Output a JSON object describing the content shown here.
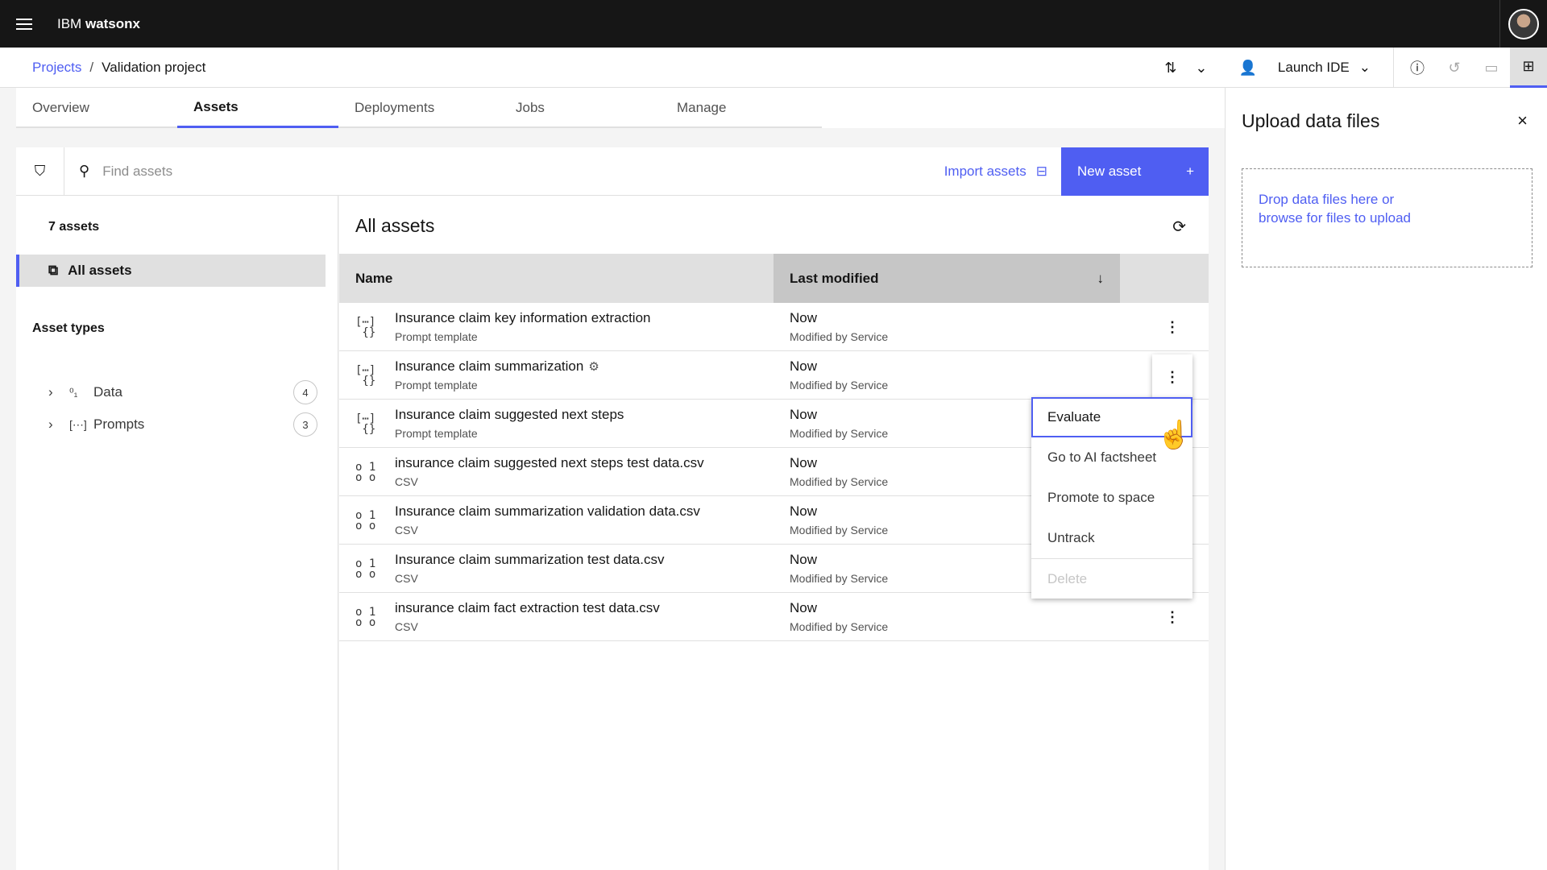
{
  "topbar": {
    "brand_prefix": "IBM",
    "brand_name": "watsonx"
  },
  "breadcrumb": {
    "projects": "Projects",
    "separator": "/",
    "current": "Validation project"
  },
  "header": {
    "launch_ide": "Launch IDE"
  },
  "tabs": [
    {
      "label": "Overview"
    },
    {
      "label": "Assets"
    },
    {
      "label": "Deployments"
    },
    {
      "label": "Jobs"
    },
    {
      "label": "Manage"
    }
  ],
  "toolbar": {
    "search_placeholder": "Find assets",
    "import_label": "Import assets",
    "new_asset_label": "New asset",
    "new_asset_plus": "+"
  },
  "left": {
    "asset_count": "7 assets",
    "all_assets": "All assets",
    "types_title": "Asset types",
    "types": [
      {
        "label": "Data",
        "count": "4"
      },
      {
        "label": "Prompts",
        "count": "3"
      }
    ]
  },
  "main": {
    "title": "All assets",
    "col_name": "Name",
    "col_modified": "Last modified",
    "rows": [
      {
        "name": "Insurance claim key information extraction",
        "type": "Prompt template",
        "modified": "Now",
        "by": "Modified by Service",
        "icon": "prompt-icon"
      },
      {
        "name": "Insurance claim summarization",
        "type": "Prompt template",
        "modified": "Now",
        "by": "Modified by Service",
        "icon": "prompt-icon"
      },
      {
        "name": "Insurance claim suggested next steps",
        "type": "Prompt template",
        "modified": "Now",
        "by": "Modified by Service",
        "icon": "prompt-icon"
      },
      {
        "name": "insurance claim suggested next steps test data.csv",
        "type": "CSV",
        "modified": "Now",
        "by": "Modified by Service",
        "icon": "data-icon"
      },
      {
        "name": "Insurance claim summarization validation data.csv",
        "type": "CSV",
        "modified": "Now",
        "by": "Modified by Service",
        "icon": "data-icon"
      },
      {
        "name": "Insurance claim summarization test data.csv",
        "type": "CSV",
        "modified": "Now",
        "by": "Modified by Service",
        "icon": "data-icon"
      },
      {
        "name": "insurance claim fact extraction test data.csv",
        "type": "CSV",
        "modified": "Now",
        "by": "Modified by Service",
        "icon": "data-icon"
      }
    ]
  },
  "context_menu": {
    "items": [
      "Evaluate",
      "Go to AI factsheet",
      "Promote to space",
      "Untrack",
      "Delete"
    ]
  },
  "side_panel": {
    "title": "Upload data files",
    "drop_line1": "Drop data files here or",
    "drop_line2": "browse for files to upload"
  },
  "colors": {
    "accent": "#4f5ef2",
    "topbar": "#161616"
  }
}
